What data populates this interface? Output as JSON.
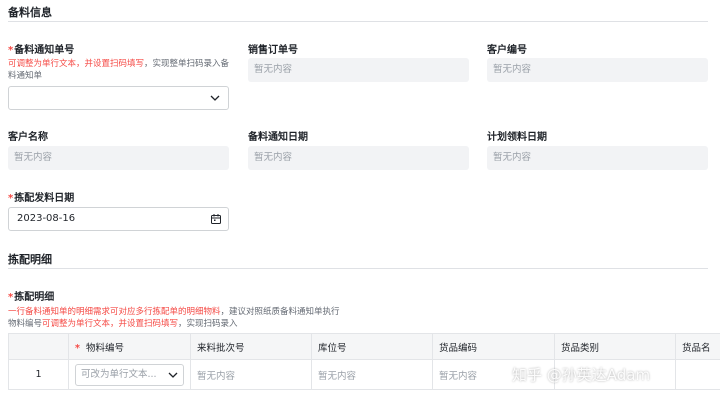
{
  "section1": {
    "title": "备料信息",
    "field_notice_no": {
      "label": "备料通知单号",
      "hint_red": "可调整为单行文本，并设置扫码填写",
      "hint_grey": "，实现整单扫码录入备料通知单"
    },
    "field_sales_order": {
      "label": "销售订单号",
      "value": "暂无内容"
    },
    "field_customer_code": {
      "label": "客户编号",
      "value": "暂无内容"
    },
    "field_customer_name": {
      "label": "客户名称",
      "value": "暂无内容"
    },
    "field_notice_date": {
      "label": "备料通知日期",
      "value": "暂无内容"
    },
    "field_plan_date": {
      "label": "计划领料日期",
      "value": "暂无内容"
    },
    "field_pick_date": {
      "label": "拣配发料日期",
      "value": "2023-08-16"
    }
  },
  "section2": {
    "title": "拣配明细",
    "subtable": {
      "label": "拣配明细",
      "hint_line1_red": "一行备料通知单的明细需求可对应多行拣配单的明细物料",
      "hint_line1_grey": "，建议对照纸质备料通知单执行",
      "hint_line2_grey_a": "物料编号",
      "hint_line2_red": "可调整为单行文本，并设置扫码填写",
      "hint_line2_grey_b": "，实现扫码录入"
    },
    "columns": [
      "物料编号",
      "来料批次号",
      "库位号",
      "货品编码",
      "货品类别",
      "货品名"
    ],
    "rows": [
      {
        "index": "1",
        "material_placeholder": "可改为单行文本...",
        "batch": "暂无内容",
        "location": "暂无内容",
        "goods_code": "暂无内容",
        "category": "",
        "name": ""
      }
    ]
  },
  "watermark": "知乎 @孙英达Adam",
  "colors": {
    "required": "#f54a45",
    "disabled_bg": "#f2f3f5",
    "header_bg": "#f5f6f7"
  },
  "icons": {
    "dropdown": "chevron-down-icon",
    "date": "calendar-icon"
  }
}
